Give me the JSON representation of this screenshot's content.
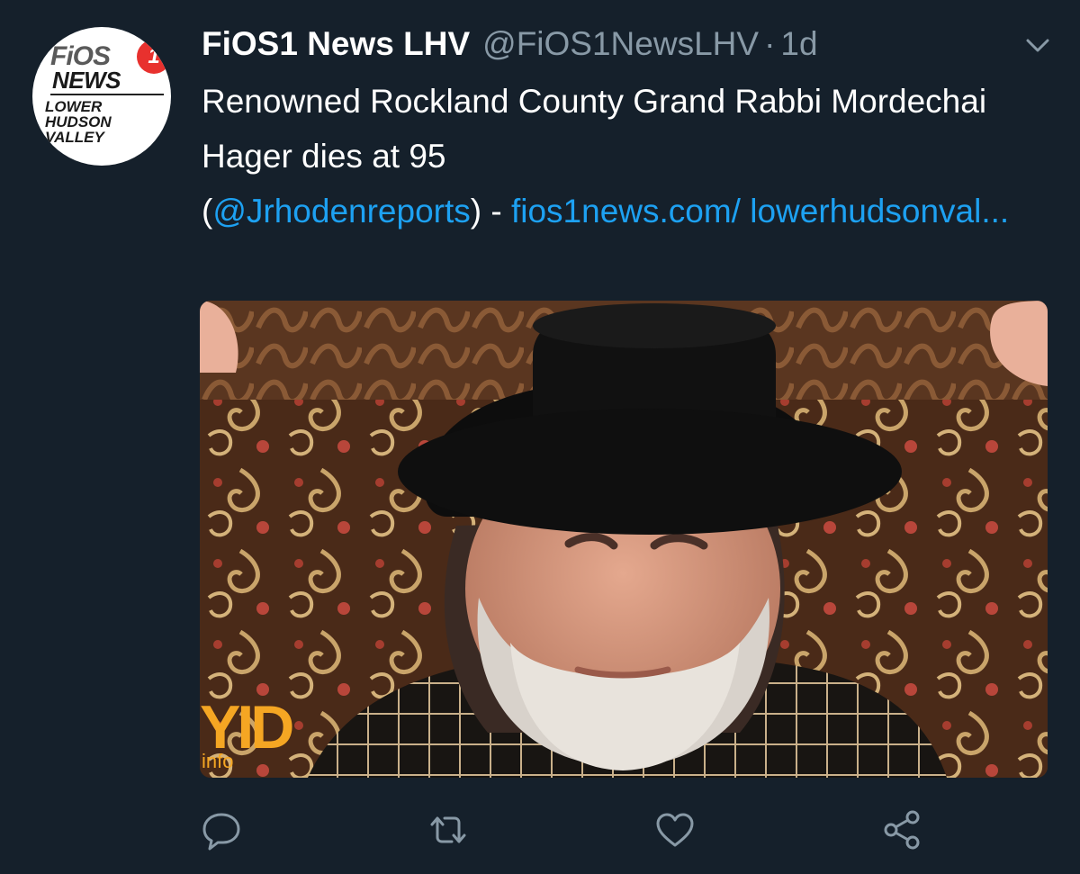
{
  "tweet": {
    "display_name": "FiOS1 News LHV",
    "handle": "@FiOS1NewsLHV",
    "separator": "·",
    "time": "1d",
    "text_main": "Renowned Rockland County Grand Rabbi Mordechai Hager dies at 95",
    "text_open_paren": "(",
    "mention": "@Jrhodenreports",
    "text_dash": ") - ",
    "link": "fios1news.com/ lowerhudsonval..."
  },
  "avatar": {
    "logo_fios": "FiOS",
    "logo_one": "1",
    "logo_news": "NEWS",
    "logo_sub": "LOWER\nHUDSON\nVALLEY"
  },
  "media": {
    "watermark_brand": "YID",
    "watermark_sub": "info"
  },
  "actions": {
    "reply_icon": "reply-icon",
    "retweet_icon": "retweet-icon",
    "like_icon": "heart-icon",
    "share_icon": "share-icon",
    "more_icon": "chevron-down-icon"
  },
  "colors": {
    "background": "#15202b",
    "text": "#ffffff",
    "muted": "#8899a6",
    "link": "#1da1f2",
    "watermark": "#f5a623"
  }
}
